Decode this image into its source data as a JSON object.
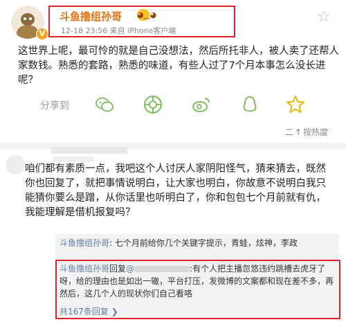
{
  "post": {
    "author": "斗鱼撸组孙哥",
    "meta": "12-18 23:56  来自 iPhone客户端",
    "text": "这世界上呢，最可怜的就是自己没想法，然后所托非人，被人卖了还帮人家数钱。熟悉的套路，熟悉的味道，有些人过了7个月本事怎么没长进呢？"
  },
  "share": {
    "label": "分享到",
    "icons": [
      "wechat-icon",
      "moments-icon",
      "weibo-icon",
      "qq-icon",
      "qzone-star-icon"
    ]
  },
  "reply_sort": {
    "label": "按热度"
  },
  "comment": {
    "text": "咱们都有素质一点，我吧这个人讨厌人家阴阳怪气，猜来猜去，既然你也回复了，就把事情说明白，让大家也明白，你故意不说明白我只能猜你要么是蹭，从你话里也听明白了，你和包包七个月前就有仇，我能理解是借机报复吗？",
    "replies": [
      {
        "author": "斗鱼撸组孙哥",
        "text": "七个月前给你几个关键字提示，青蛙，炫神，李政"
      },
      {
        "author": "斗鱼撸组孙哥",
        "reply_word": "回复",
        "at": "@",
        "text": ":有个人把主播忽悠违约跳槽去虎牙了呀，给的理由也是如出一辙，平台打压，发微博的文案都和现在差不多，再然后，这几个人的现状你们自己看咯"
      }
    ],
    "more_replies": "共167条回复 ❯"
  },
  "colors": {
    "highlight_border": "#e0222b",
    "username": "#5d7ea8",
    "vip_name": "#e8720f"
  }
}
